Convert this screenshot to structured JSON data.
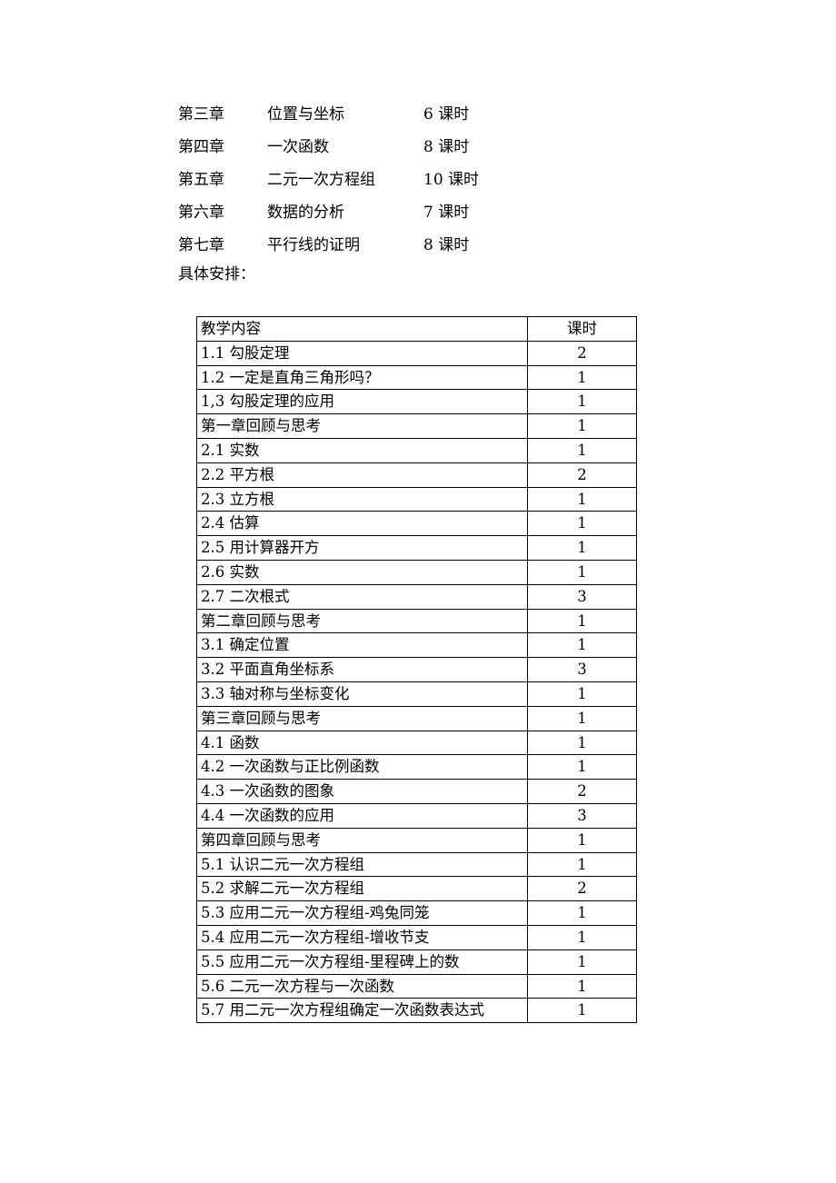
{
  "chapter_summary": {
    "rows": [
      {
        "chapter": "第三章",
        "title": "位置与坐标",
        "hours": "6 课时"
      },
      {
        "chapter": "第四章",
        "title": "一次函数",
        "hours": "8 课时"
      },
      {
        "chapter": "第五章",
        "title": "二元一次方程组",
        "hours": "10 课时"
      },
      {
        "chapter": "第六章",
        "title": "数据的分析",
        "hours": "7 课时"
      },
      {
        "chapter": "第七章",
        "title": "平行线的证明",
        "hours": "8 课时"
      }
    ]
  },
  "arrangement": {
    "caption": "具体安排："
  },
  "schedule_table": {
    "headers": {
      "content": "教学内容",
      "hours": "课时"
    },
    "rows": [
      {
        "content": "1.1 勾股定理",
        "hours": "2"
      },
      {
        "content": "1.2 一定是直角三角形吗？",
        "hours": "1"
      },
      {
        "content": "1,3 勾股定理的应用",
        "hours": "1"
      },
      {
        "content": "第一章回顾与思考",
        "hours": "1"
      },
      {
        "content": "2.1 实数",
        "hours": "1"
      },
      {
        "content": "2.2 平方根",
        "hours": "2"
      },
      {
        "content": "2.3 立方根",
        "hours": "1"
      },
      {
        "content": "2.4 估算",
        "hours": "1"
      },
      {
        "content": "2.5 用计算器开方",
        "hours": "1"
      },
      {
        "content": "2.6 实数",
        "hours": "1"
      },
      {
        "content": "2.7 二次根式",
        "hours": "3"
      },
      {
        "content": "第二章回顾与思考",
        "hours": "1"
      },
      {
        "content": "3.1 确定位置",
        "hours": "1"
      },
      {
        "content": "3.2 平面直角坐标系",
        "hours": "3"
      },
      {
        "content": "3.3 轴对称与坐标变化",
        "hours": "1"
      },
      {
        "content": "第三章回顾与思考",
        "hours": "1"
      },
      {
        "content": "4.1 函数",
        "hours": "1"
      },
      {
        "content": "4.2 一次函数与正比例函数",
        "hours": "1"
      },
      {
        "content": "4.3 一次函数的图象",
        "hours": "2"
      },
      {
        "content": "4.4 一次函数的应用",
        "hours": "3"
      },
      {
        "content": "第四章回顾与思考",
        "hours": "1"
      },
      {
        "content": "5.1 认识二元一次方程组",
        "hours": "1"
      },
      {
        "content": "5.2 求解二元一次方程组",
        "hours": "2"
      },
      {
        "content": "5.3 应用二元一次方程组-鸡兔同笼",
        "hours": "1"
      },
      {
        "content": "5.4 应用二元一次方程组-增收节支",
        "hours": "1"
      },
      {
        "content": "5.5 应用二元一次方程组-里程碑上的数",
        "hours": "1"
      },
      {
        "content": "5.6 二元一次方程与一次函数",
        "hours": "1"
      },
      {
        "content": "5.7 用二元一次方程组确定一次函数表达式",
        "hours": "1"
      }
    ]
  }
}
